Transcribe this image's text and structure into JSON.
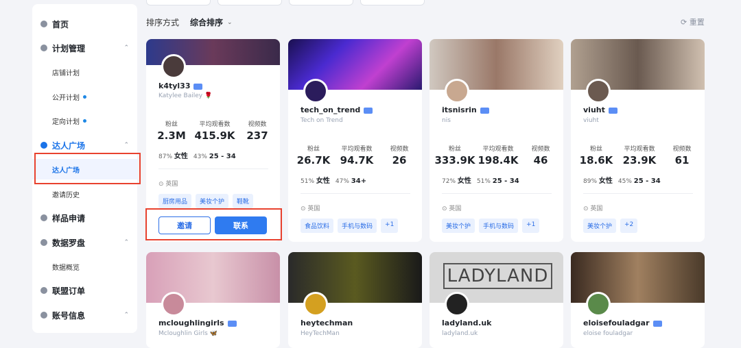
{
  "sidebar": {
    "items": [
      {
        "label": "首页",
        "type": "top",
        "icon": "home-icon"
      },
      {
        "label": "计划管理",
        "type": "top",
        "icon": "plan-icon",
        "chevron": "⌃"
      },
      {
        "label": "店铺计划",
        "type": "sub"
      },
      {
        "label": "公开计划",
        "type": "sub",
        "dot": true
      },
      {
        "label": "定向计划",
        "type": "sub",
        "dot": true
      },
      {
        "label": "达人广场",
        "type": "top",
        "icon": "creator-icon",
        "chevron": "⌃",
        "active": true
      },
      {
        "label": "达人广场",
        "type": "sub",
        "selected": true
      },
      {
        "label": "邀请历史",
        "type": "sub"
      },
      {
        "label": "样品申请",
        "type": "top",
        "icon": "sample-icon"
      },
      {
        "label": "数据罗盘",
        "type": "top",
        "icon": "compass-icon",
        "chevron": "⌃"
      },
      {
        "label": "数据概览",
        "type": "sub"
      },
      {
        "label": "联盟订单",
        "type": "top",
        "icon": "order-icon"
      },
      {
        "label": "账号信息",
        "type": "top",
        "icon": "account-icon",
        "chevron": "⌃"
      }
    ]
  },
  "sort": {
    "label": "排序方式",
    "value": "综合排序",
    "caret": "⌄"
  },
  "reset": {
    "icon": "refresh-icon",
    "label": "⟳ 重置"
  },
  "stat_headers": [
    "粉丝",
    "平均观看数",
    "视频数"
  ],
  "cards": [
    {
      "username": "k4tyl33",
      "nickname": "Katylee Bailey 🌹",
      "followers": "2.3M",
      "avg_views": "415.9K",
      "videos": "237",
      "female_pct": "87%",
      "female_label": "女性",
      "age_pct": "43%",
      "age": "25 - 34",
      "location": "英国",
      "tags": [
        "厨房用品",
        "美妆个护",
        "鞋靴"
      ],
      "invite": "邀请",
      "contact": "联系",
      "cover_color": "#2d3a8c",
      "avatar_color": "#4a3b3b"
    },
    {
      "username": "tech_on_trend",
      "nickname": "Tech on Trend",
      "followers": "26.7K",
      "avg_views": "94.7K",
      "videos": "26",
      "female_pct": "51%",
      "female_label": "女性",
      "age_pct": "47%",
      "age": "34+",
      "location": "英国",
      "tags": [
        "食品饮料",
        "手机与数码",
        "+1"
      ],
      "cover_color": "#3b1f8a",
      "avatar_color": "#2b1c5c"
    },
    {
      "username": "itsnisrin",
      "nickname": "nis",
      "followers": "333.9K",
      "avg_views": "198.4K",
      "videos": "46",
      "female_pct": "72%",
      "female_label": "女性",
      "age_pct": "51%",
      "age": "25 - 34",
      "location": "英国",
      "tags": [
        "美妆个护",
        "手机与数码",
        "+1"
      ],
      "cover_color": "#b89a8a",
      "avatar_color": "#c8a890"
    },
    {
      "username": "viuht",
      "nickname": "viuht",
      "followers": "18.6K",
      "avg_views": "23.9K",
      "videos": "61",
      "female_pct": "89%",
      "female_label": "女性",
      "age_pct": "45%",
      "age": "25 - 34",
      "location": "英国",
      "tags": [
        "美妆个护",
        "+2"
      ],
      "cover_color": "#8a7a70",
      "avatar_color": "#6b5a50"
    },
    {
      "username": "mcloughlingirls",
      "nickname": "Mcloughlin Girls 🦋",
      "cover_color": "#d4a0b0",
      "avatar_color": "#c88a9a"
    },
    {
      "username": "heytechman",
      "nickname": "HeyTechMan",
      "cover_color": "#2a2a2a",
      "avatar_color": "#d4a020"
    },
    {
      "username": "ladyland.uk",
      "nickname": "ladyland.uk",
      "cover_text": "LADYLAND",
      "cover_color": "#d8d8d8",
      "avatar_color": "#222222"
    },
    {
      "username": "eloisefouladgar",
      "nickname": "eloise fouladgar",
      "cover_color": "#6a4a3a",
      "avatar_color": "#5a8a4a"
    }
  ]
}
